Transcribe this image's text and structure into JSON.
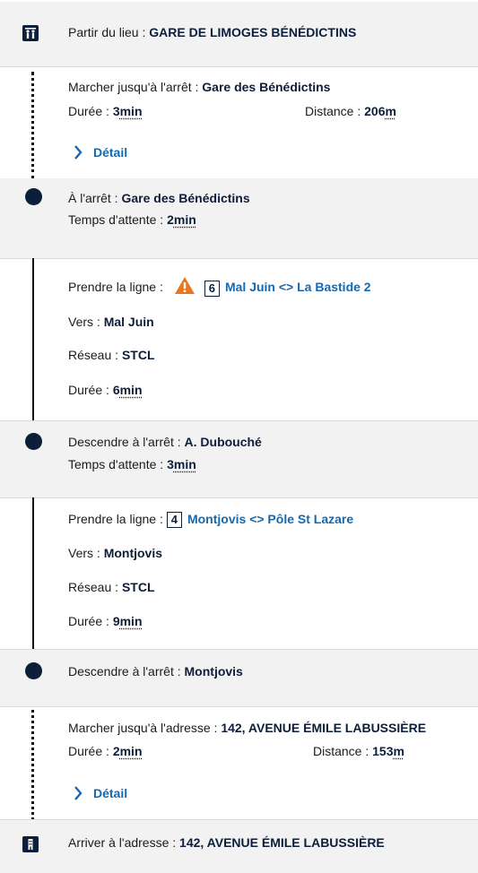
{
  "start": {
    "label": "Partir du lieu : ",
    "place": "GARE DE LIMOGES BÉNÉDICTINS",
    "icon": "walking-people-icon"
  },
  "walk1": {
    "label": "Marcher jusqu'à l'arrêt : ",
    "stop": "Gare des Bénédictins",
    "duration_label": "Durée : ",
    "duration_value": "3",
    "duration_unit": "min",
    "distance_label": "Distance : ",
    "distance_value": "206",
    "distance_unit": "m",
    "detail": "Détail"
  },
  "stop1": {
    "label": "À l'arrêt : ",
    "stop": "Gare des Bénédictins",
    "wait_label": "Temps d'attente : ",
    "wait_value": "2",
    "wait_unit": "min"
  },
  "ride1": {
    "label": "Prendre la ligne : ",
    "line_number": "6",
    "line_name": "Mal Juin <> La Bastide 2",
    "toward_label": "Vers : ",
    "toward": "Mal Juin",
    "network_label": "Réseau : ",
    "network": "STCL",
    "duration_label": "Durée : ",
    "duration_value": "6",
    "duration_unit": "min",
    "warning_color": "#e87722"
  },
  "stop2": {
    "label": "Descendre à l'arrêt : ",
    "stop": "A. Dubouché",
    "wait_label": "Temps d'attente : ",
    "wait_value": "3",
    "wait_unit": "min"
  },
  "ride2": {
    "label": "Prendre la ligne : ",
    "line_number": "4",
    "line_name": "Montjovis <> Pôle St Lazare",
    "toward_label": "Vers : ",
    "toward": "Montjovis",
    "network_label": "Réseau : ",
    "network": "STCL",
    "duration_label": "Durée : ",
    "duration_value": "9",
    "duration_unit": "min"
  },
  "stop3": {
    "label": "Descendre à l'arrêt : ",
    "stop": "Montjovis"
  },
  "walk2": {
    "label": "Marcher jusqu'à l'adresse : ",
    "address": "142, AVENUE ÉMILE LABUSSIÈRE",
    "duration_label": "Durée : ",
    "duration_value": "2",
    "duration_unit": "min",
    "distance_label": "Distance : ",
    "distance_value": "153",
    "distance_unit": "m",
    "detail": "Détail"
  },
  "arrive": {
    "label": "Arriver à l'adresse : ",
    "address": "142, AVENUE ÉMILE LABUSSIÈRE",
    "icon": "building-icon"
  },
  "colors": {
    "navy": "#0d1e3a",
    "link": "#1569b0",
    "band": "#f2f2f2"
  }
}
